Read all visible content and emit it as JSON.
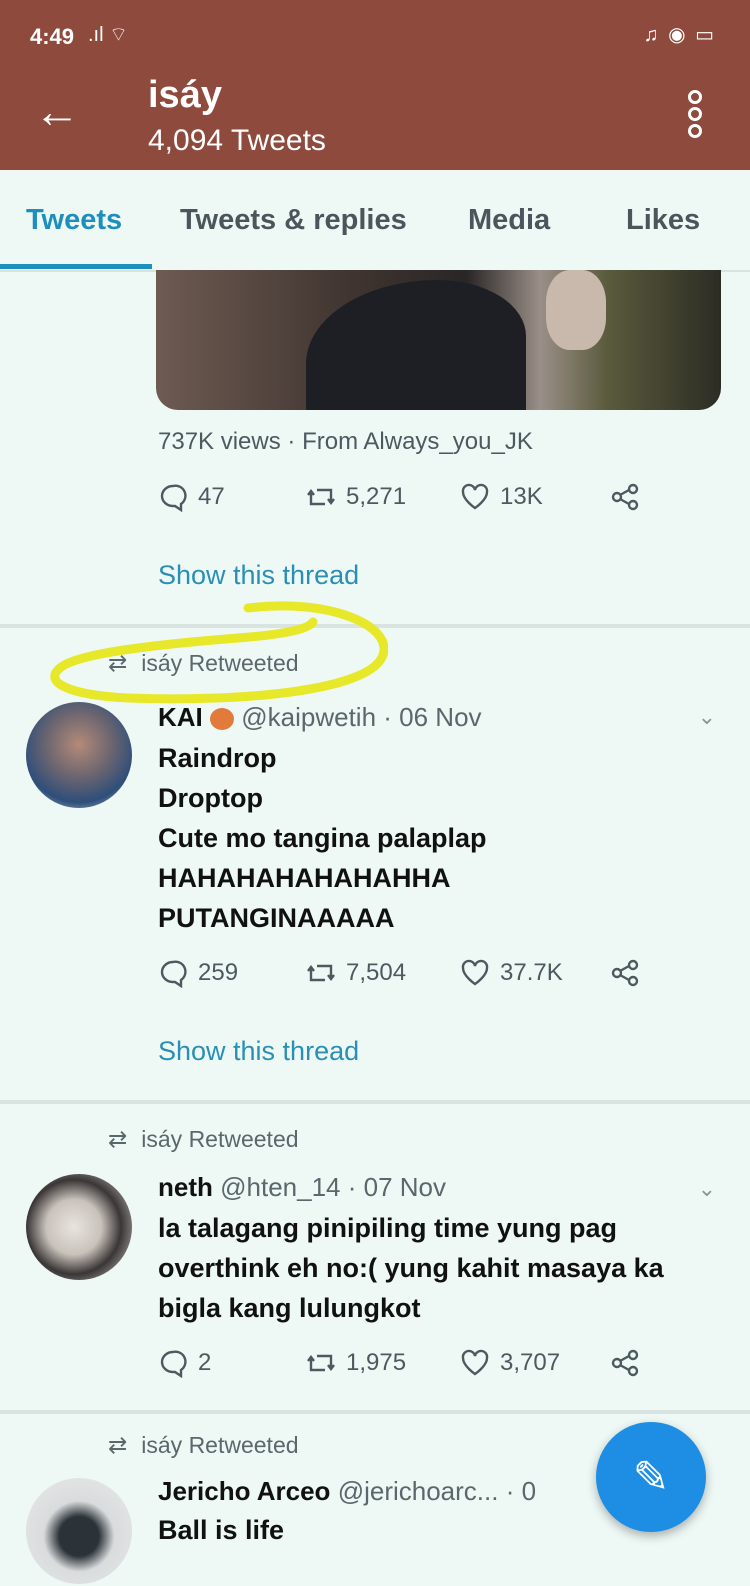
{
  "status_bar": {
    "time": "4:49",
    "signal": ".ıl ⌔",
    "right_icons": "♫ ◉ ▭"
  },
  "header": {
    "name": "isáy",
    "tweet_count": "4,094 Tweets"
  },
  "tabs": [
    "Tweets",
    "Tweets & replies",
    "Media",
    "Likes"
  ],
  "active_tab": "Tweets",
  "tweet1": {
    "views": "737K views",
    "source": "· From Always_you_JK",
    "replies": "47",
    "retweets": "5,271",
    "likes": "13K",
    "show_thread": "Show this thread"
  },
  "tweet2": {
    "retweeted_by": "isáy Retweeted",
    "name": "KAI",
    "handle": "@kaipwetih",
    "date": "· 06 Nov",
    "lines": [
      "Raindrop",
      "Droptop",
      "Cute mo tangina palaplap",
      "HAHAHAHAHAHAHHA",
      "PUTANGINAAAAA"
    ],
    "replies": "259",
    "retweets": "7,504",
    "likes": "37.7K",
    "show_thread": "Show this thread"
  },
  "tweet3": {
    "retweeted_by": "isáy Retweeted",
    "name": "neth",
    "handle": "@hten_14",
    "date": "· 07 Nov",
    "lines": [
      "la talagang pinipiling time yung pag",
      "overthink eh no:( yung kahit masaya ka",
      "bigla kang lulungkot"
    ],
    "replies": "2",
    "retweets": "1,975",
    "likes": "3,707"
  },
  "tweet4": {
    "retweeted_by": "isáy Retweeted",
    "name": "Jericho Arceo",
    "handle": "@jerichoarc...",
    "date": "· 0",
    "lines": [
      "Ball is life"
    ]
  },
  "colors": {
    "header": "#8e4a3c",
    "accent": "#1c8fbc",
    "fab": "#1d8ee4",
    "highlight": "#e8e82a"
  }
}
